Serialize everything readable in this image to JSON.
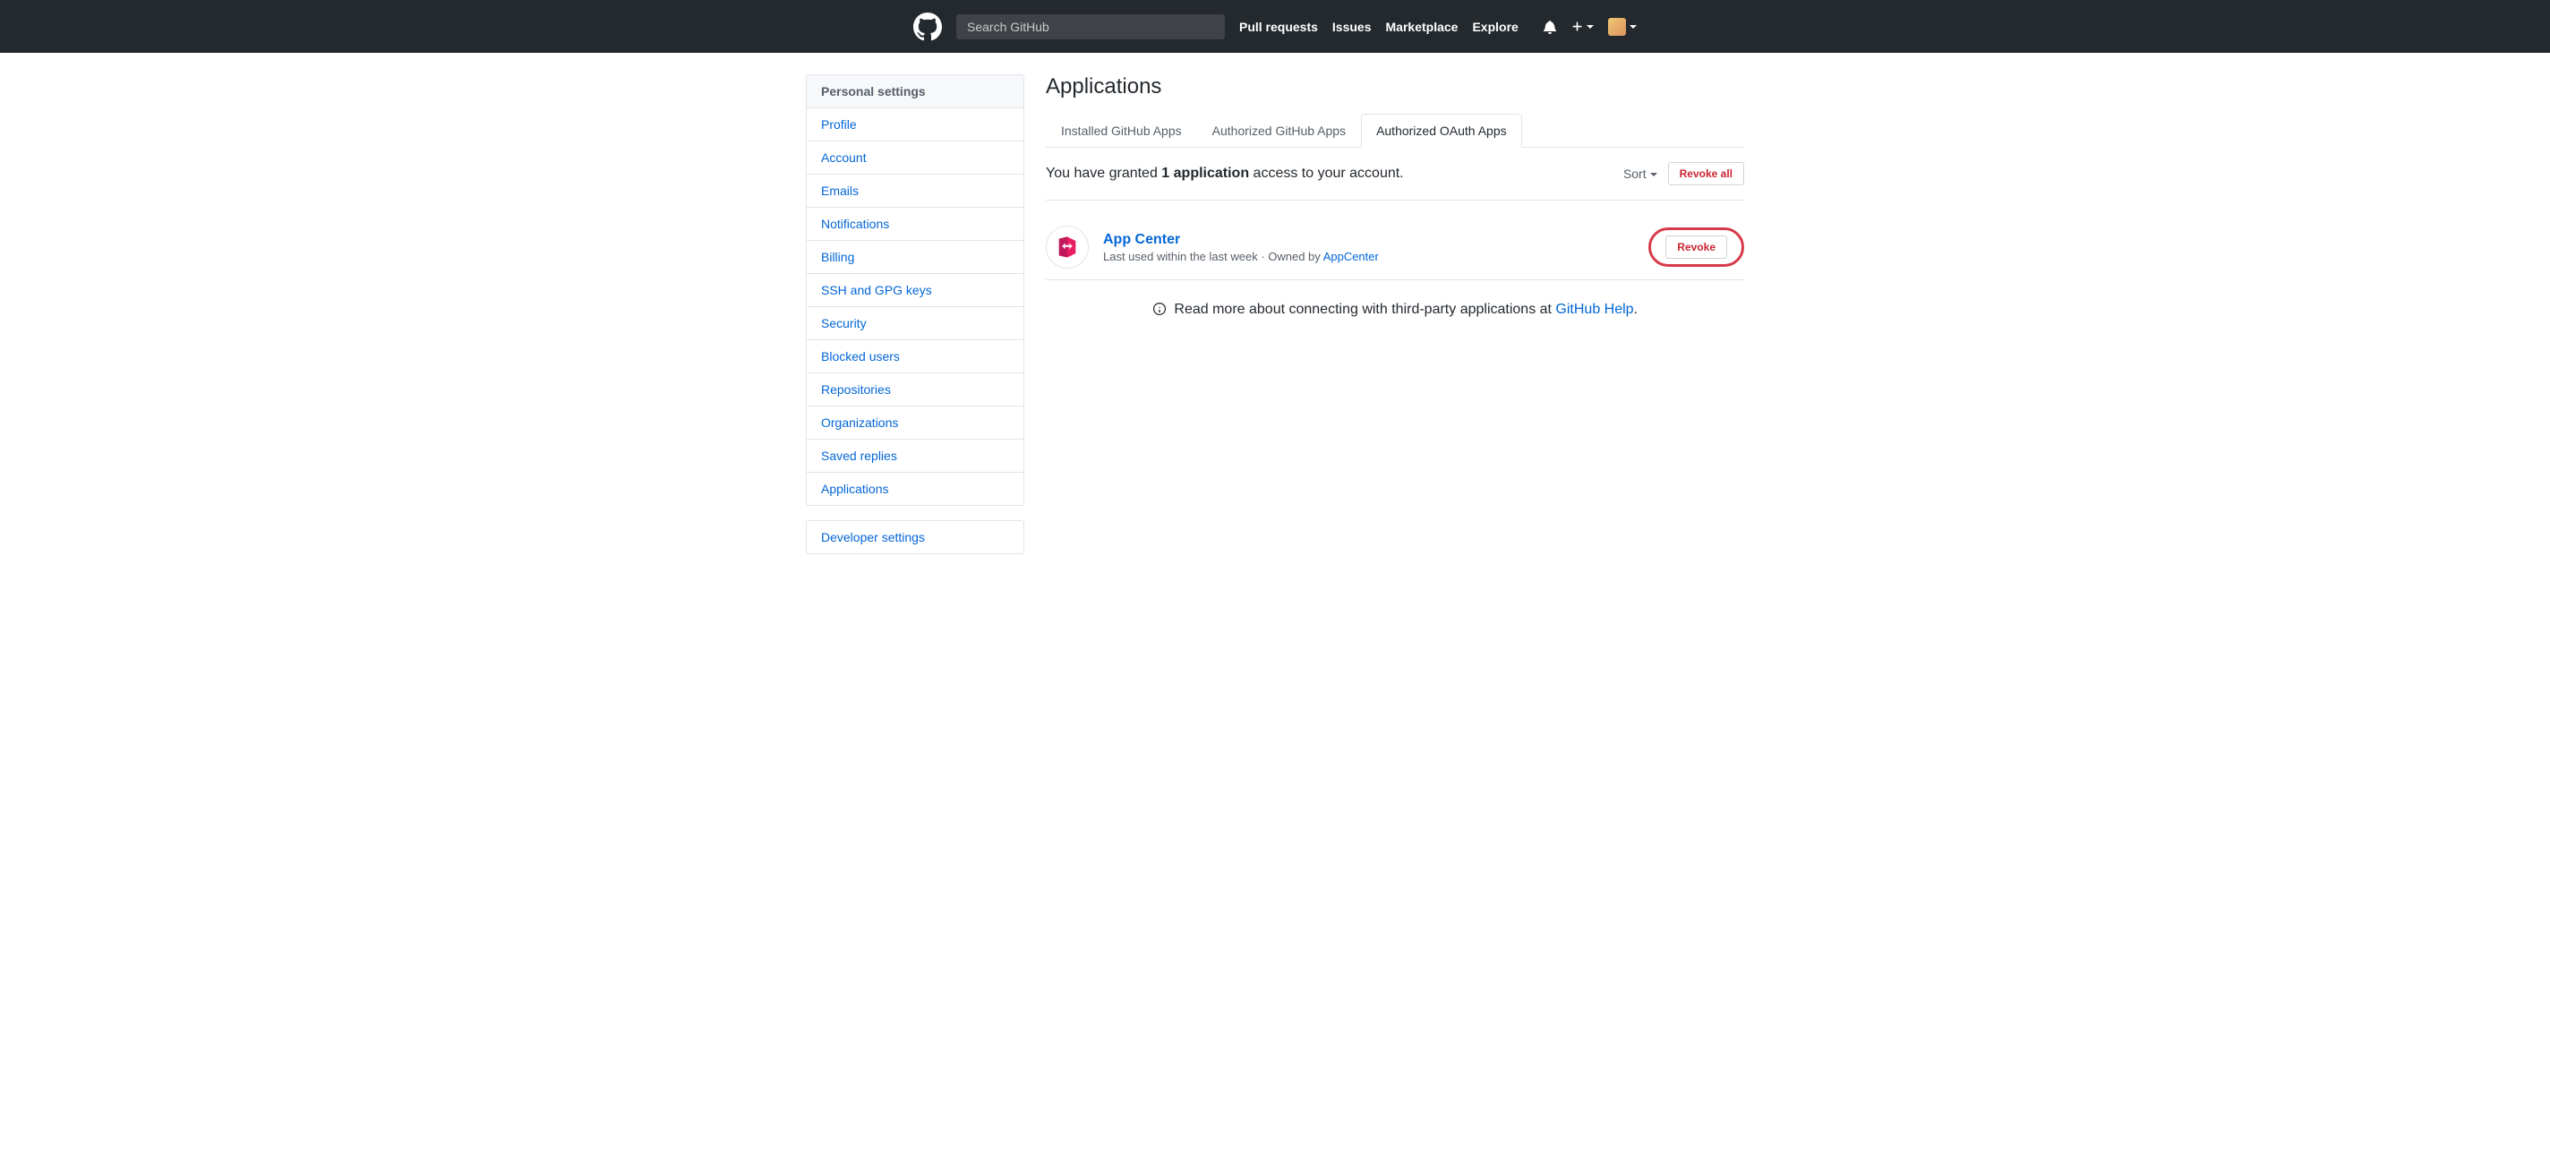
{
  "header": {
    "search_placeholder": "Search GitHub",
    "nav": [
      "Pull requests",
      "Issues",
      "Marketplace",
      "Explore"
    ]
  },
  "sidebar": {
    "heading": "Personal settings",
    "items": [
      "Profile",
      "Account",
      "Emails",
      "Notifications",
      "Billing",
      "SSH and GPG keys",
      "Security",
      "Blocked users",
      "Repositories",
      "Organizations",
      "Saved replies",
      "Applications"
    ],
    "dev_heading": "Developer settings"
  },
  "main": {
    "title": "Applications",
    "tabs": [
      "Installed GitHub Apps",
      "Authorized GitHub Apps",
      "Authorized OAuth Apps"
    ],
    "active_tab": 2,
    "summary_prefix": "You have granted ",
    "summary_bold": "1 application",
    "summary_suffix": " access to your account.",
    "sort_label": "Sort",
    "revoke_all": "Revoke all",
    "app": {
      "name": "App Center",
      "meta_prefix": "Last used within the last week · Owned by ",
      "owner": "AppCenter",
      "revoke": "Revoke"
    },
    "help_prefix": "Read more about connecting with third-party applications at ",
    "help_link": "GitHub Help",
    "help_suffix": "."
  }
}
